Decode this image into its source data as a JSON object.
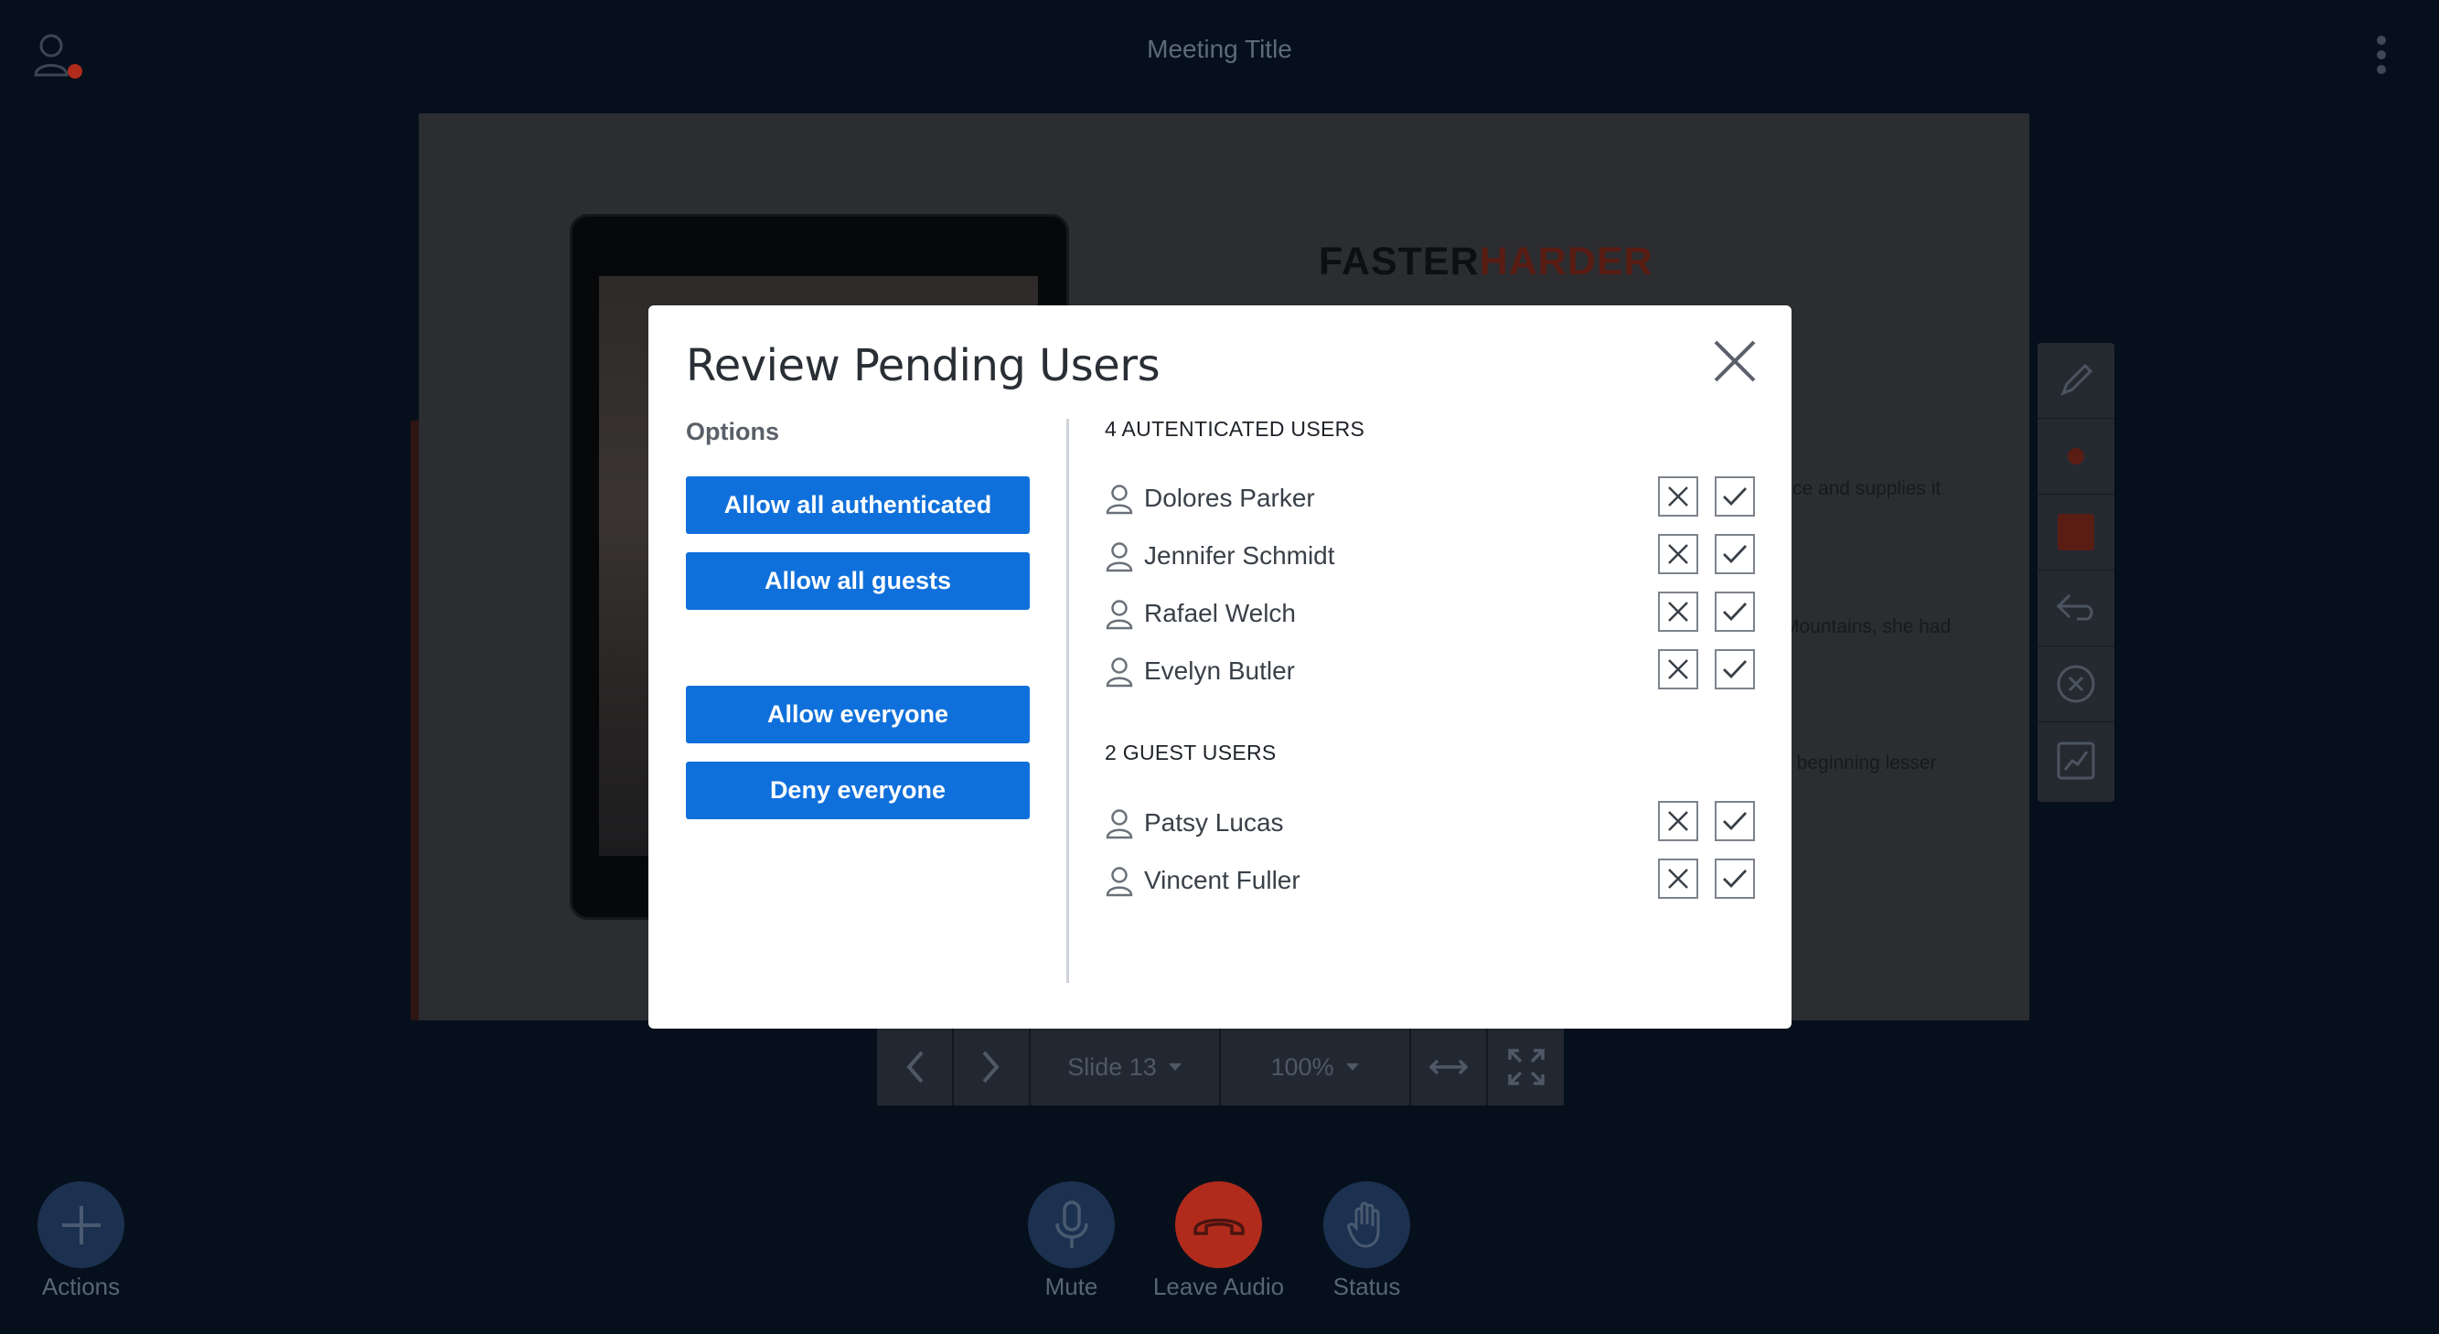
{
  "header": {
    "meeting_title": "Meeting Title",
    "user_icon": "user-icon",
    "menu_icon": "kebab-menu-icon"
  },
  "presentation": {
    "brand_part1": "FASTER",
    "brand_part2": "HARDER",
    "text_fragments": [
      "ce and supplies it",
      "Mountains, she had",
      ", beginning lesser"
    ]
  },
  "tools": [
    "pencil-icon",
    "color-dot-icon",
    "fill-square-icon",
    "undo-icon",
    "clear-icon",
    "multi-user-icon"
  ],
  "slide_controls": {
    "slide_label": "Slide 13",
    "zoom_label": "100%"
  },
  "bottom_bar": {
    "actions_label": "Actions",
    "mute_label": "Mute",
    "leave_audio_label": "Leave Audio",
    "status_label": "Status"
  },
  "modal": {
    "title": "Review Pending Users",
    "options_label": "Options",
    "buttons": {
      "allow_authenticated": "Allow all authenticated",
      "allow_guests": "Allow all guests",
      "allow_everyone": "Allow everyone",
      "deny_everyone": "Deny everyone"
    },
    "authenticated_heading": "4  AUTENTICATED USERS",
    "guest_heading": "2 GUEST USERS",
    "authenticated_users": [
      "Dolores Parker",
      "Jennifer Schmidt",
      "Rafael Welch",
      "Evelyn Butler"
    ],
    "guest_users": [
      "Patsy Lucas",
      "Vincent Fuller"
    ]
  },
  "colors": {
    "primary_button": "#1070db",
    "leave_audio": "#b02b1b",
    "backdrop": "#06101c"
  }
}
